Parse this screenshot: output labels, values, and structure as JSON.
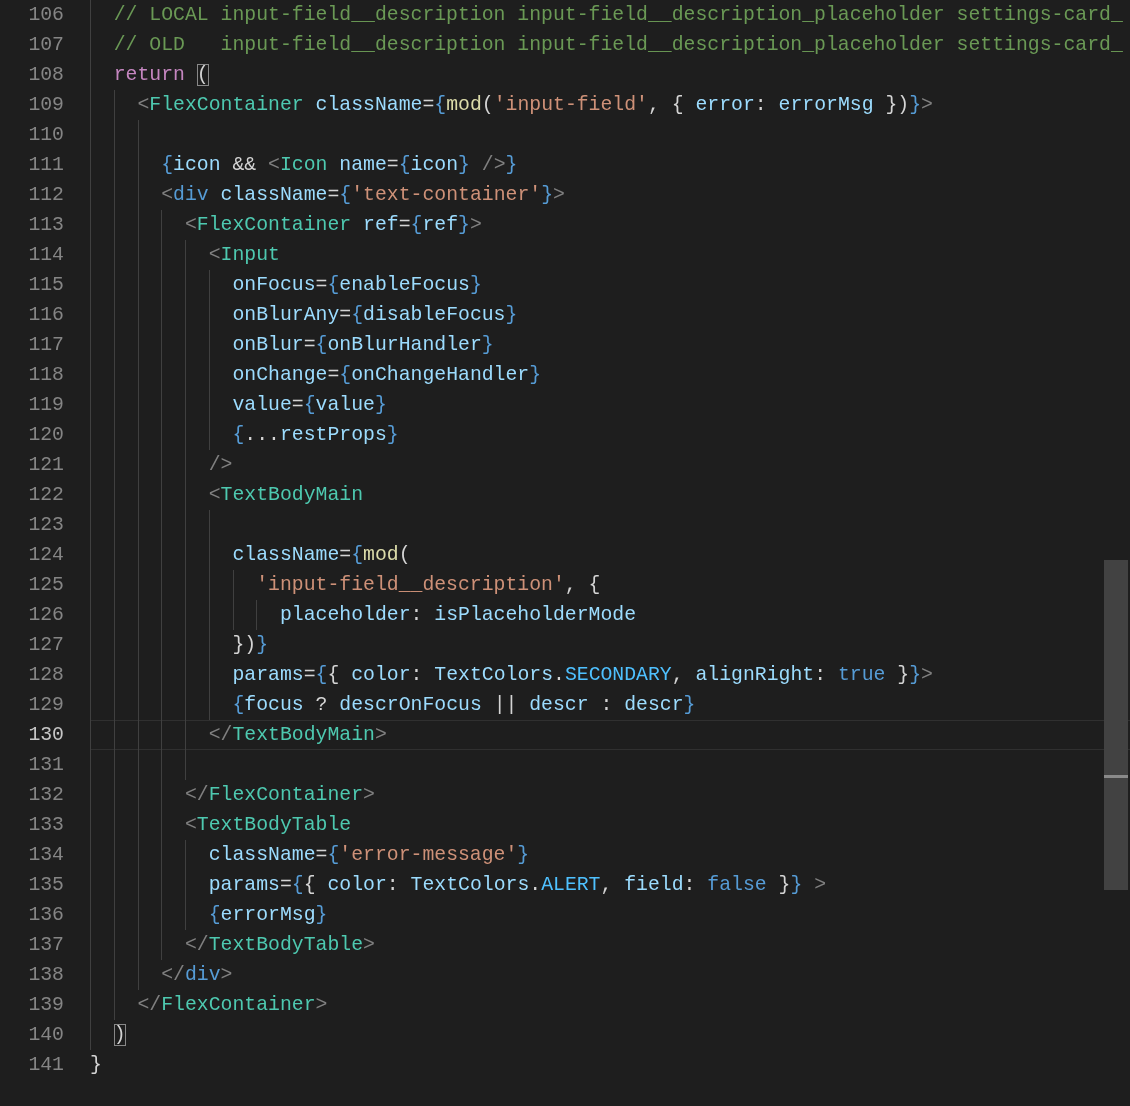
{
  "editor": {
    "lines": [
      {
        "number": "106",
        "selected": false,
        "tokens": [
          {
            "kind": "c",
            "text": "  // LOCAL input-field__description input-field__description_placeholder settings-card_"
          }
        ]
      },
      {
        "number": "107",
        "selected": false,
        "tokens": [
          {
            "kind": "c",
            "text": "  // OLD   input-field__description input-field__description_placeholder settings-card_"
          }
        ]
      },
      {
        "number": "108",
        "selected": false,
        "tokens": [
          {
            "kind": "k",
            "text": "  return "
          },
          {
            "kind": "m",
            "text": "("
          }
        ]
      },
      {
        "number": "109",
        "selected": false,
        "tokens": [
          {
            "kind": "p",
            "text": "    <"
          },
          {
            "kind": "t",
            "text": "FlexContainer "
          },
          {
            "kind": "a",
            "text": "className"
          },
          {
            "kind": "d",
            "text": "="
          },
          {
            "kind": "b",
            "text": "{"
          },
          {
            "kind": "f",
            "text": "mod"
          },
          {
            "kind": "d",
            "text": "("
          },
          {
            "kind": "s",
            "text": "'input-field'"
          },
          {
            "kind": "d",
            "text": ", { "
          },
          {
            "kind": "a",
            "text": "error"
          },
          {
            "kind": "d",
            "text": ": "
          },
          {
            "kind": "a",
            "text": "errorMsg"
          },
          {
            "kind": "d",
            "text": " })"
          },
          {
            "kind": "b",
            "text": "}"
          },
          {
            "kind": "p",
            "text": ">"
          }
        ]
      },
      {
        "number": "110",
        "selected": false
      },
      {
        "number": "111",
        "selected": false,
        "tokens": [
          {
            "kind": "b",
            "text": "      {"
          },
          {
            "kind": "a",
            "text": "icon"
          },
          {
            "kind": "d",
            "text": " && "
          },
          {
            "kind": "p",
            "text": "<"
          },
          {
            "kind": "t",
            "text": "Icon "
          },
          {
            "kind": "a",
            "text": "name"
          },
          {
            "kind": "d",
            "text": "="
          },
          {
            "kind": "b",
            "text": "{"
          },
          {
            "kind": "a",
            "text": "icon"
          },
          {
            "kind": "b",
            "text": "} "
          },
          {
            "kind": "p",
            "text": "/>"
          },
          {
            "kind": "b",
            "text": "}"
          }
        ]
      },
      {
        "number": "112",
        "selected": false,
        "tokens": [
          {
            "kind": "p",
            "text": "      <"
          },
          {
            "kind": "h",
            "text": "div "
          },
          {
            "kind": "a",
            "text": "className"
          },
          {
            "kind": "d",
            "text": "="
          },
          {
            "kind": "b",
            "text": "{"
          },
          {
            "kind": "s",
            "text": "'text-container'"
          },
          {
            "kind": "b",
            "text": "}"
          },
          {
            "kind": "p",
            "text": ">"
          }
        ]
      },
      {
        "number": "113",
        "selected": false,
        "tokens": [
          {
            "kind": "p",
            "text": "        <"
          },
          {
            "kind": "t",
            "text": "FlexContainer "
          },
          {
            "kind": "a",
            "text": "ref"
          },
          {
            "kind": "d",
            "text": "="
          },
          {
            "kind": "b",
            "text": "{"
          },
          {
            "kind": "a",
            "text": "ref"
          },
          {
            "kind": "b",
            "text": "}"
          },
          {
            "kind": "p",
            "text": ">"
          }
        ]
      },
      {
        "number": "114",
        "selected": false,
        "tokens": [
          {
            "kind": "p",
            "text": "          <"
          },
          {
            "kind": "t",
            "text": "Input"
          }
        ]
      },
      {
        "number": "115",
        "selected": false,
        "tokens": [
          {
            "kind": "a",
            "text": "            onFocus"
          },
          {
            "kind": "d",
            "text": "="
          },
          {
            "kind": "b",
            "text": "{"
          },
          {
            "kind": "a",
            "text": "enableFocus"
          },
          {
            "kind": "b",
            "text": "}"
          }
        ]
      },
      {
        "number": "116",
        "selected": false,
        "tokens": [
          {
            "kind": "a",
            "text": "            onBlurAny"
          },
          {
            "kind": "d",
            "text": "="
          },
          {
            "kind": "b",
            "text": "{"
          },
          {
            "kind": "a",
            "text": "disableFocus"
          },
          {
            "kind": "b",
            "text": "}"
          }
        ]
      },
      {
        "number": "117",
        "selected": false,
        "tokens": [
          {
            "kind": "a",
            "text": "            onBlur"
          },
          {
            "kind": "d",
            "text": "="
          },
          {
            "kind": "b",
            "text": "{"
          },
          {
            "kind": "a",
            "text": "onBlurHandler"
          },
          {
            "kind": "b",
            "text": "}"
          }
        ]
      },
      {
        "number": "118",
        "selected": false,
        "tokens": [
          {
            "kind": "a",
            "text": "            onChange"
          },
          {
            "kind": "d",
            "text": "="
          },
          {
            "kind": "b",
            "text": "{"
          },
          {
            "kind": "a",
            "text": "onChangeHandler"
          },
          {
            "kind": "b",
            "text": "}"
          }
        ]
      },
      {
        "number": "119",
        "selected": false,
        "tokens": [
          {
            "kind": "a",
            "text": "            value"
          },
          {
            "kind": "d",
            "text": "="
          },
          {
            "kind": "b",
            "text": "{"
          },
          {
            "kind": "a",
            "text": "value"
          },
          {
            "kind": "b",
            "text": "}"
          }
        ]
      },
      {
        "number": "120",
        "selected": false,
        "tokens": [
          {
            "kind": "b",
            "text": "            {"
          },
          {
            "kind": "d",
            "text": "..."
          },
          {
            "kind": "a",
            "text": "restProps"
          },
          {
            "kind": "b",
            "text": "}"
          }
        ]
      },
      {
        "number": "121",
        "selected": false,
        "tokens": [
          {
            "kind": "p",
            "text": "          />"
          }
        ]
      },
      {
        "number": "122",
        "selected": false,
        "tokens": [
          {
            "kind": "p",
            "text": "          <"
          },
          {
            "kind": "t",
            "text": "TextBodyMain"
          }
        ]
      },
      {
        "number": "123",
        "selected": false
      },
      {
        "number": "124",
        "selected": false,
        "tokens": [
          {
            "kind": "a",
            "text": "            className"
          },
          {
            "kind": "d",
            "text": "="
          },
          {
            "kind": "b",
            "text": "{"
          },
          {
            "kind": "f",
            "text": "mod"
          },
          {
            "kind": "d",
            "text": "("
          }
        ]
      },
      {
        "number": "125",
        "selected": false,
        "tokens": [
          {
            "kind": "s",
            "text": "              'input-field__description'"
          },
          {
            "kind": "d",
            "text": ", {"
          }
        ]
      },
      {
        "number": "126",
        "selected": false,
        "tokens": [
          {
            "kind": "a",
            "text": "                placeholder"
          },
          {
            "kind": "d",
            "text": ": "
          },
          {
            "kind": "a",
            "text": "isPlaceholderMode"
          }
        ]
      },
      {
        "number": "127",
        "selected": false,
        "tokens": [
          {
            "kind": "d",
            "text": "            })"
          },
          {
            "kind": "b",
            "text": "}"
          }
        ]
      },
      {
        "number": "128",
        "selected": false,
        "tokens": [
          {
            "kind": "a",
            "text": "            params"
          },
          {
            "kind": "d",
            "text": "="
          },
          {
            "kind": "b",
            "text": "{"
          },
          {
            "kind": "d",
            "text": "{ "
          },
          {
            "kind": "a",
            "text": "color"
          },
          {
            "kind": "d",
            "text": ": "
          },
          {
            "kind": "a",
            "text": "TextColors"
          },
          {
            "kind": "d",
            "text": "."
          },
          {
            "kind": "n",
            "text": "SECONDARY"
          },
          {
            "kind": "d",
            "text": ", "
          },
          {
            "kind": "a",
            "text": "alignRight"
          },
          {
            "kind": "d",
            "text": ": "
          },
          {
            "kind": "l",
            "text": "true"
          },
          {
            "kind": "d",
            "text": " }"
          },
          {
            "kind": "b",
            "text": "}"
          },
          {
            "kind": "p",
            "text": ">"
          }
        ]
      },
      {
        "number": "129",
        "selected": false,
        "tokens": [
          {
            "kind": "b",
            "text": "            {"
          },
          {
            "kind": "a",
            "text": "focus"
          },
          {
            "kind": "d",
            "text": " ? "
          },
          {
            "kind": "a",
            "text": "descrOnFocus"
          },
          {
            "kind": "d",
            "text": " || "
          },
          {
            "kind": "a",
            "text": "descr"
          },
          {
            "kind": "d",
            "text": " : "
          },
          {
            "kind": "a",
            "text": "descr"
          },
          {
            "kind": "b",
            "text": "}"
          }
        ]
      },
      {
        "number": "130",
        "selected": true,
        "tokens": [
          {
            "kind": "p",
            "text": "          </"
          },
          {
            "kind": "t",
            "text": "TextBodyMain"
          },
          {
            "kind": "p",
            "text": ">"
          }
        ]
      },
      {
        "number": "131",
        "selected": false
      },
      {
        "number": "132",
        "selected": false,
        "tokens": [
          {
            "kind": "p",
            "text": "        </"
          },
          {
            "kind": "t",
            "text": "FlexContainer"
          },
          {
            "kind": "p",
            "text": ">"
          }
        ]
      },
      {
        "number": "133",
        "selected": false,
        "tokens": [
          {
            "kind": "p",
            "text": "        <"
          },
          {
            "kind": "t",
            "text": "TextBodyTable"
          }
        ]
      },
      {
        "number": "134",
        "selected": false,
        "tokens": [
          {
            "kind": "a",
            "text": "          className"
          },
          {
            "kind": "d",
            "text": "="
          },
          {
            "kind": "b",
            "text": "{"
          },
          {
            "kind": "s",
            "text": "'error-message'"
          },
          {
            "kind": "b",
            "text": "}"
          }
        ]
      },
      {
        "number": "135",
        "selected": false,
        "tokens": [
          {
            "kind": "a",
            "text": "          params"
          },
          {
            "kind": "d",
            "text": "="
          },
          {
            "kind": "b",
            "text": "{"
          },
          {
            "kind": "d",
            "text": "{ "
          },
          {
            "kind": "a",
            "text": "color"
          },
          {
            "kind": "d",
            "text": ": "
          },
          {
            "kind": "a",
            "text": "TextColors"
          },
          {
            "kind": "d",
            "text": "."
          },
          {
            "kind": "n",
            "text": "ALERT"
          },
          {
            "kind": "d",
            "text": ", "
          },
          {
            "kind": "a",
            "text": "field"
          },
          {
            "kind": "d",
            "text": ": "
          },
          {
            "kind": "l",
            "text": "false"
          },
          {
            "kind": "d",
            "text": " }"
          },
          {
            "kind": "b",
            "text": "} "
          },
          {
            "kind": "p",
            "text": ">"
          }
        ]
      },
      {
        "number": "136",
        "selected": false,
        "tokens": [
          {
            "kind": "b",
            "text": "          {"
          },
          {
            "kind": "a",
            "text": "errorMsg"
          },
          {
            "kind": "b",
            "text": "}"
          }
        ]
      },
      {
        "number": "137",
        "selected": false,
        "tokens": [
          {
            "kind": "p",
            "text": "        </"
          },
          {
            "kind": "t",
            "text": "TextBodyTable"
          },
          {
            "kind": "p",
            "text": ">"
          }
        ]
      },
      {
        "number": "138",
        "selected": false,
        "tokens": [
          {
            "kind": "p",
            "text": "      </"
          },
          {
            "kind": "h",
            "text": "div"
          },
          {
            "kind": "p",
            "text": ">"
          }
        ]
      },
      {
        "number": "139",
        "selected": false,
        "tokens": [
          {
            "kind": "p",
            "text": "    </"
          },
          {
            "kind": "t",
            "text": "FlexContainer"
          },
          {
            "kind": "p",
            "text": ">"
          }
        ]
      },
      {
        "number": "140",
        "selected": false,
        "tokens": [
          {
            "kind": "m",
            "text": "  )"
          }
        ]
      },
      {
        "number": "141",
        "selected": false,
        "tokens": [
          {
            "kind": "d",
            "text": "}"
          }
        ]
      }
    ]
  }
}
